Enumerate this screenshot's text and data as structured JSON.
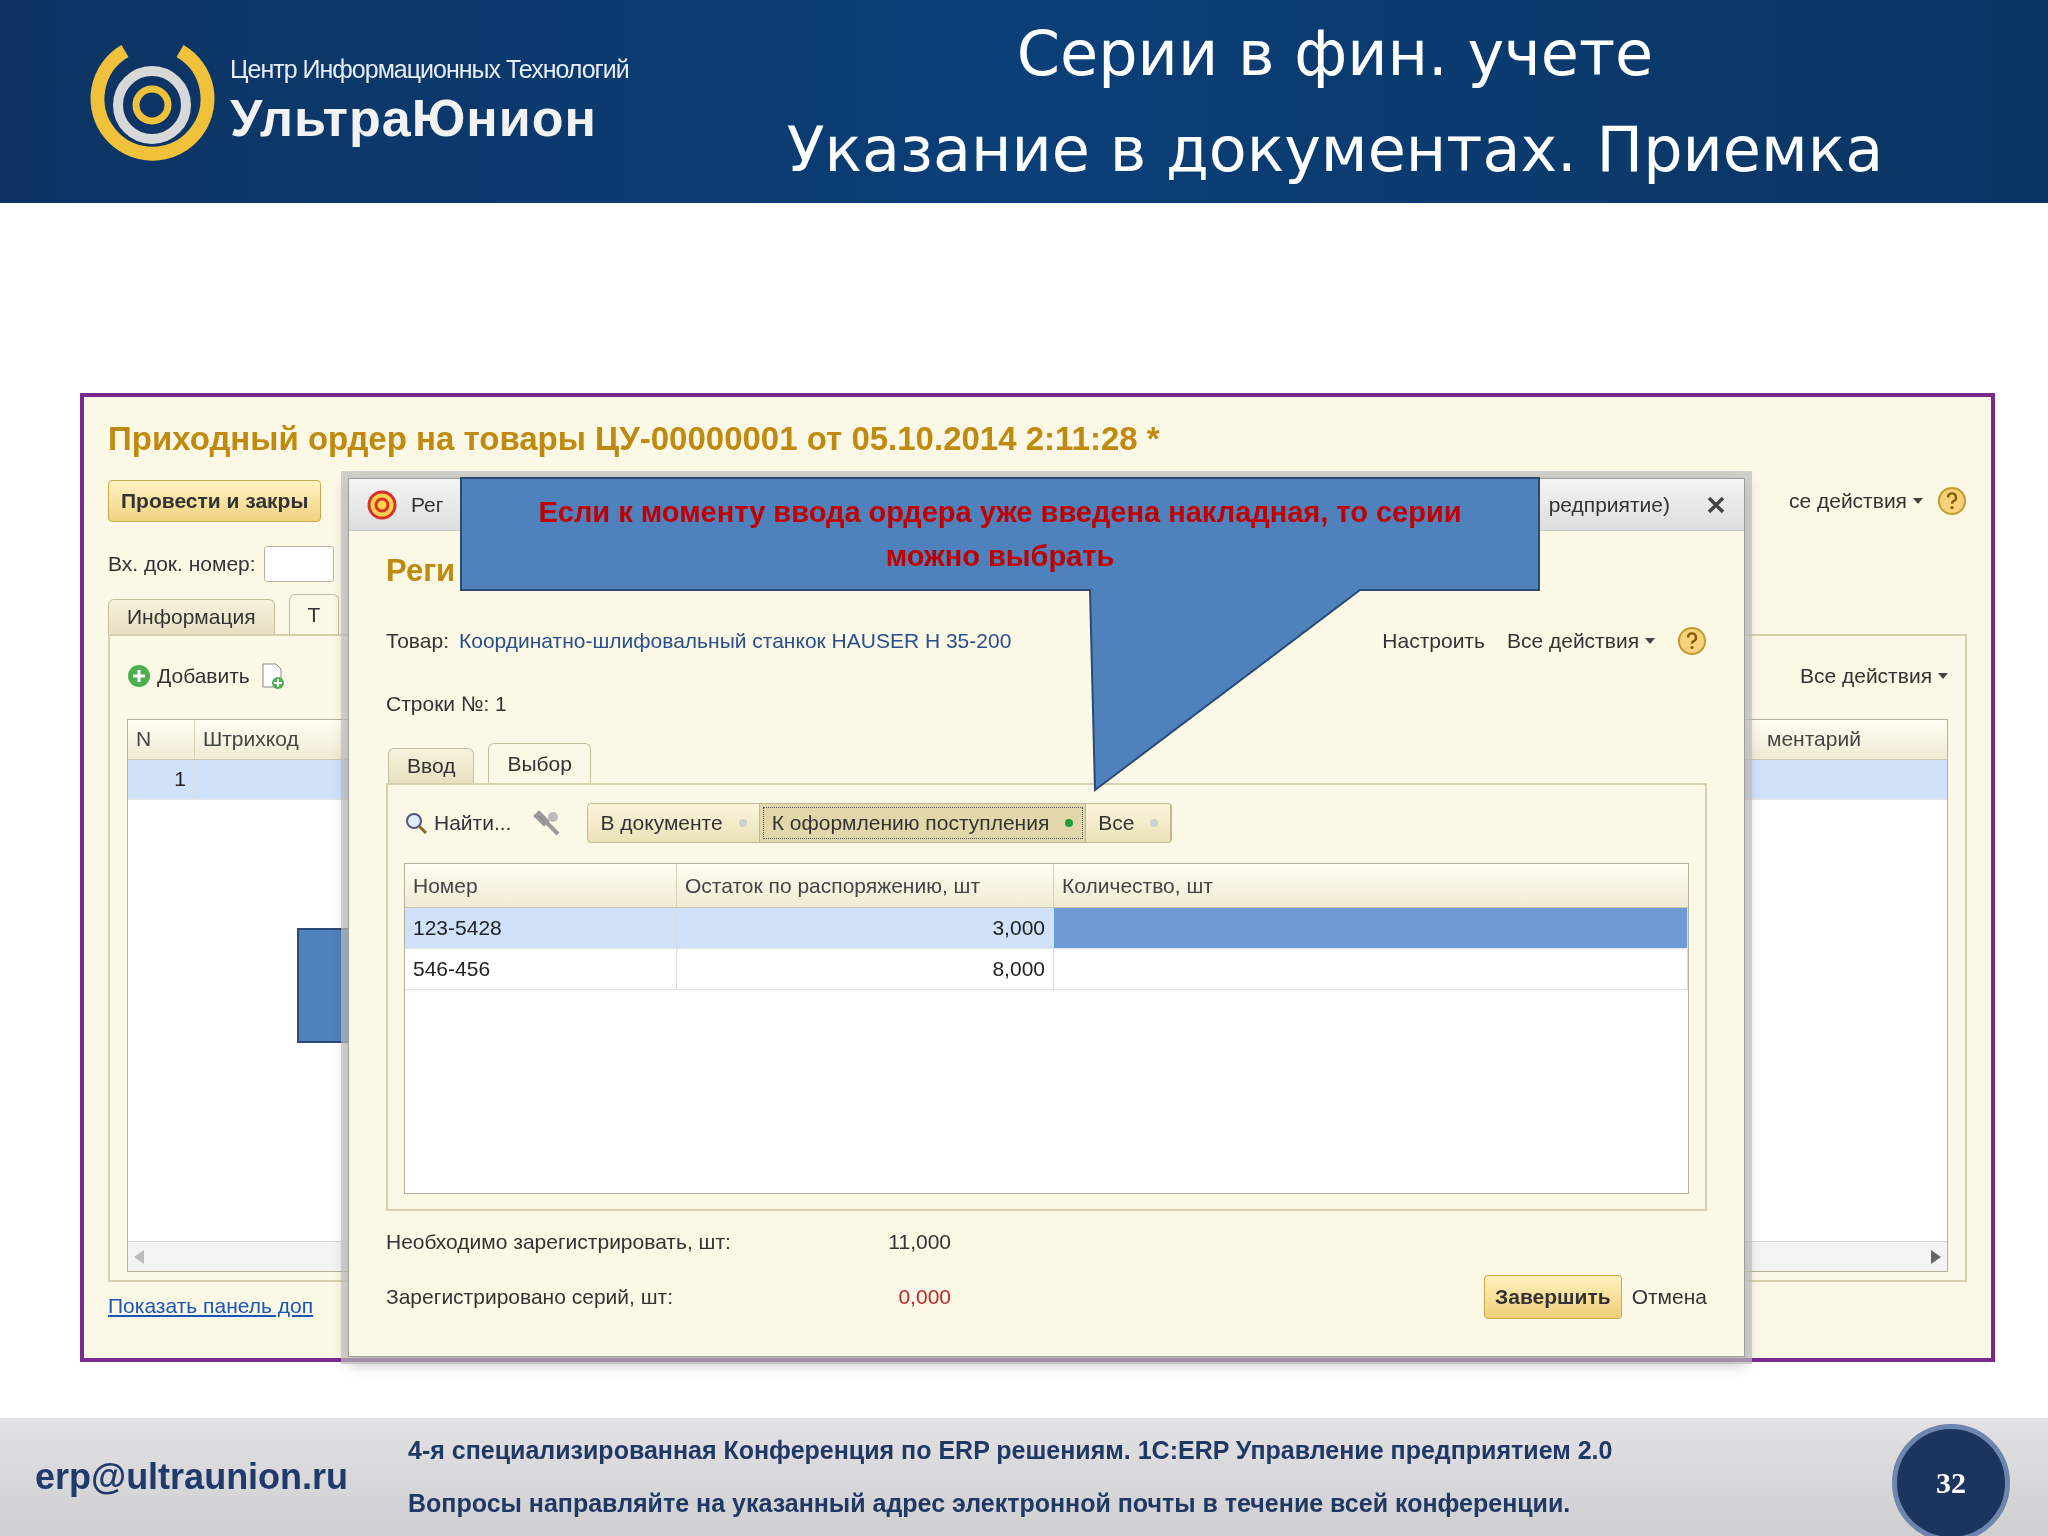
{
  "slide": {
    "logo": {
      "tagline": "Центр Информационных Технологий",
      "name": "УльтраЮнион"
    },
    "title_lines": [
      "Серии в фин. учете",
      "Указание в документах. Приемка"
    ]
  },
  "main_window": {
    "title": "Приходный ордер на товары ЦУ-00000001 от 05.10.2014 2:11:28 *",
    "post_button": "Провести и закры",
    "top_actions": "се действия",
    "number_label": "Вх. док. номер:",
    "tabs": [
      {
        "label": "Информация",
        "selected": false
      },
      {
        "label": "Т",
        "selected": true
      }
    ],
    "add_button": "Добавить",
    "table_actions": "Все действия",
    "table": {
      "columns": [
        "N",
        "Штрихкод",
        "ментарий"
      ],
      "rows": [
        {
          "n": "1",
          "selected": true
        }
      ]
    },
    "panel_link": "Показать панель доп"
  },
  "dialog": {
    "title_start": "Рег",
    "title_end": "редприятие)",
    "heading": "Реги",
    "product_label": "Товар:",
    "product": "Координатно-шлифовальный станкок HAUSER H 35-200",
    "configure": "Настроить",
    "all_actions": "Все действия",
    "rows_label": "Строки №: 1",
    "tabs": [
      {
        "label": "Ввод",
        "selected": false
      },
      {
        "label": "Выбор",
        "selected": true
      }
    ],
    "find": "Найти...",
    "filters": [
      {
        "label": "В документе",
        "selected": false
      },
      {
        "label": "К оформлению поступления",
        "selected": true
      },
      {
        "label": "Все",
        "selected": false
      }
    ],
    "table": {
      "columns": [
        "Номер",
        "Остаток по распоряжению, шт",
        "Количество, шт"
      ],
      "rows": [
        {
          "number": "123-5428",
          "remaining": "3,000",
          "selected": true
        },
        {
          "number": "546-456",
          "remaining": "8,000",
          "selected": false
        }
      ]
    },
    "required_label": "Необходимо зарегистрировать, шт:",
    "required_value": "11,000",
    "registered_label": "Зарегистрировано серий, шт:",
    "registered_value": "0,000",
    "finish_button": "Завершить",
    "cancel": "Отмена"
  },
  "callout": {
    "text": "Если к моменту ввода ордера уже введена накладная, то серии можно выбрать"
  },
  "footer": {
    "email": "erp@ultraunion.ru",
    "lines": [
      "4-я специализированная Конференция  по ERP решениям. 1С:ERP Управление предприятием 2.0",
      "Вопросы направляйте на указанный адрес электронной почты в течение всей конференции."
    ],
    "page": "32"
  }
}
